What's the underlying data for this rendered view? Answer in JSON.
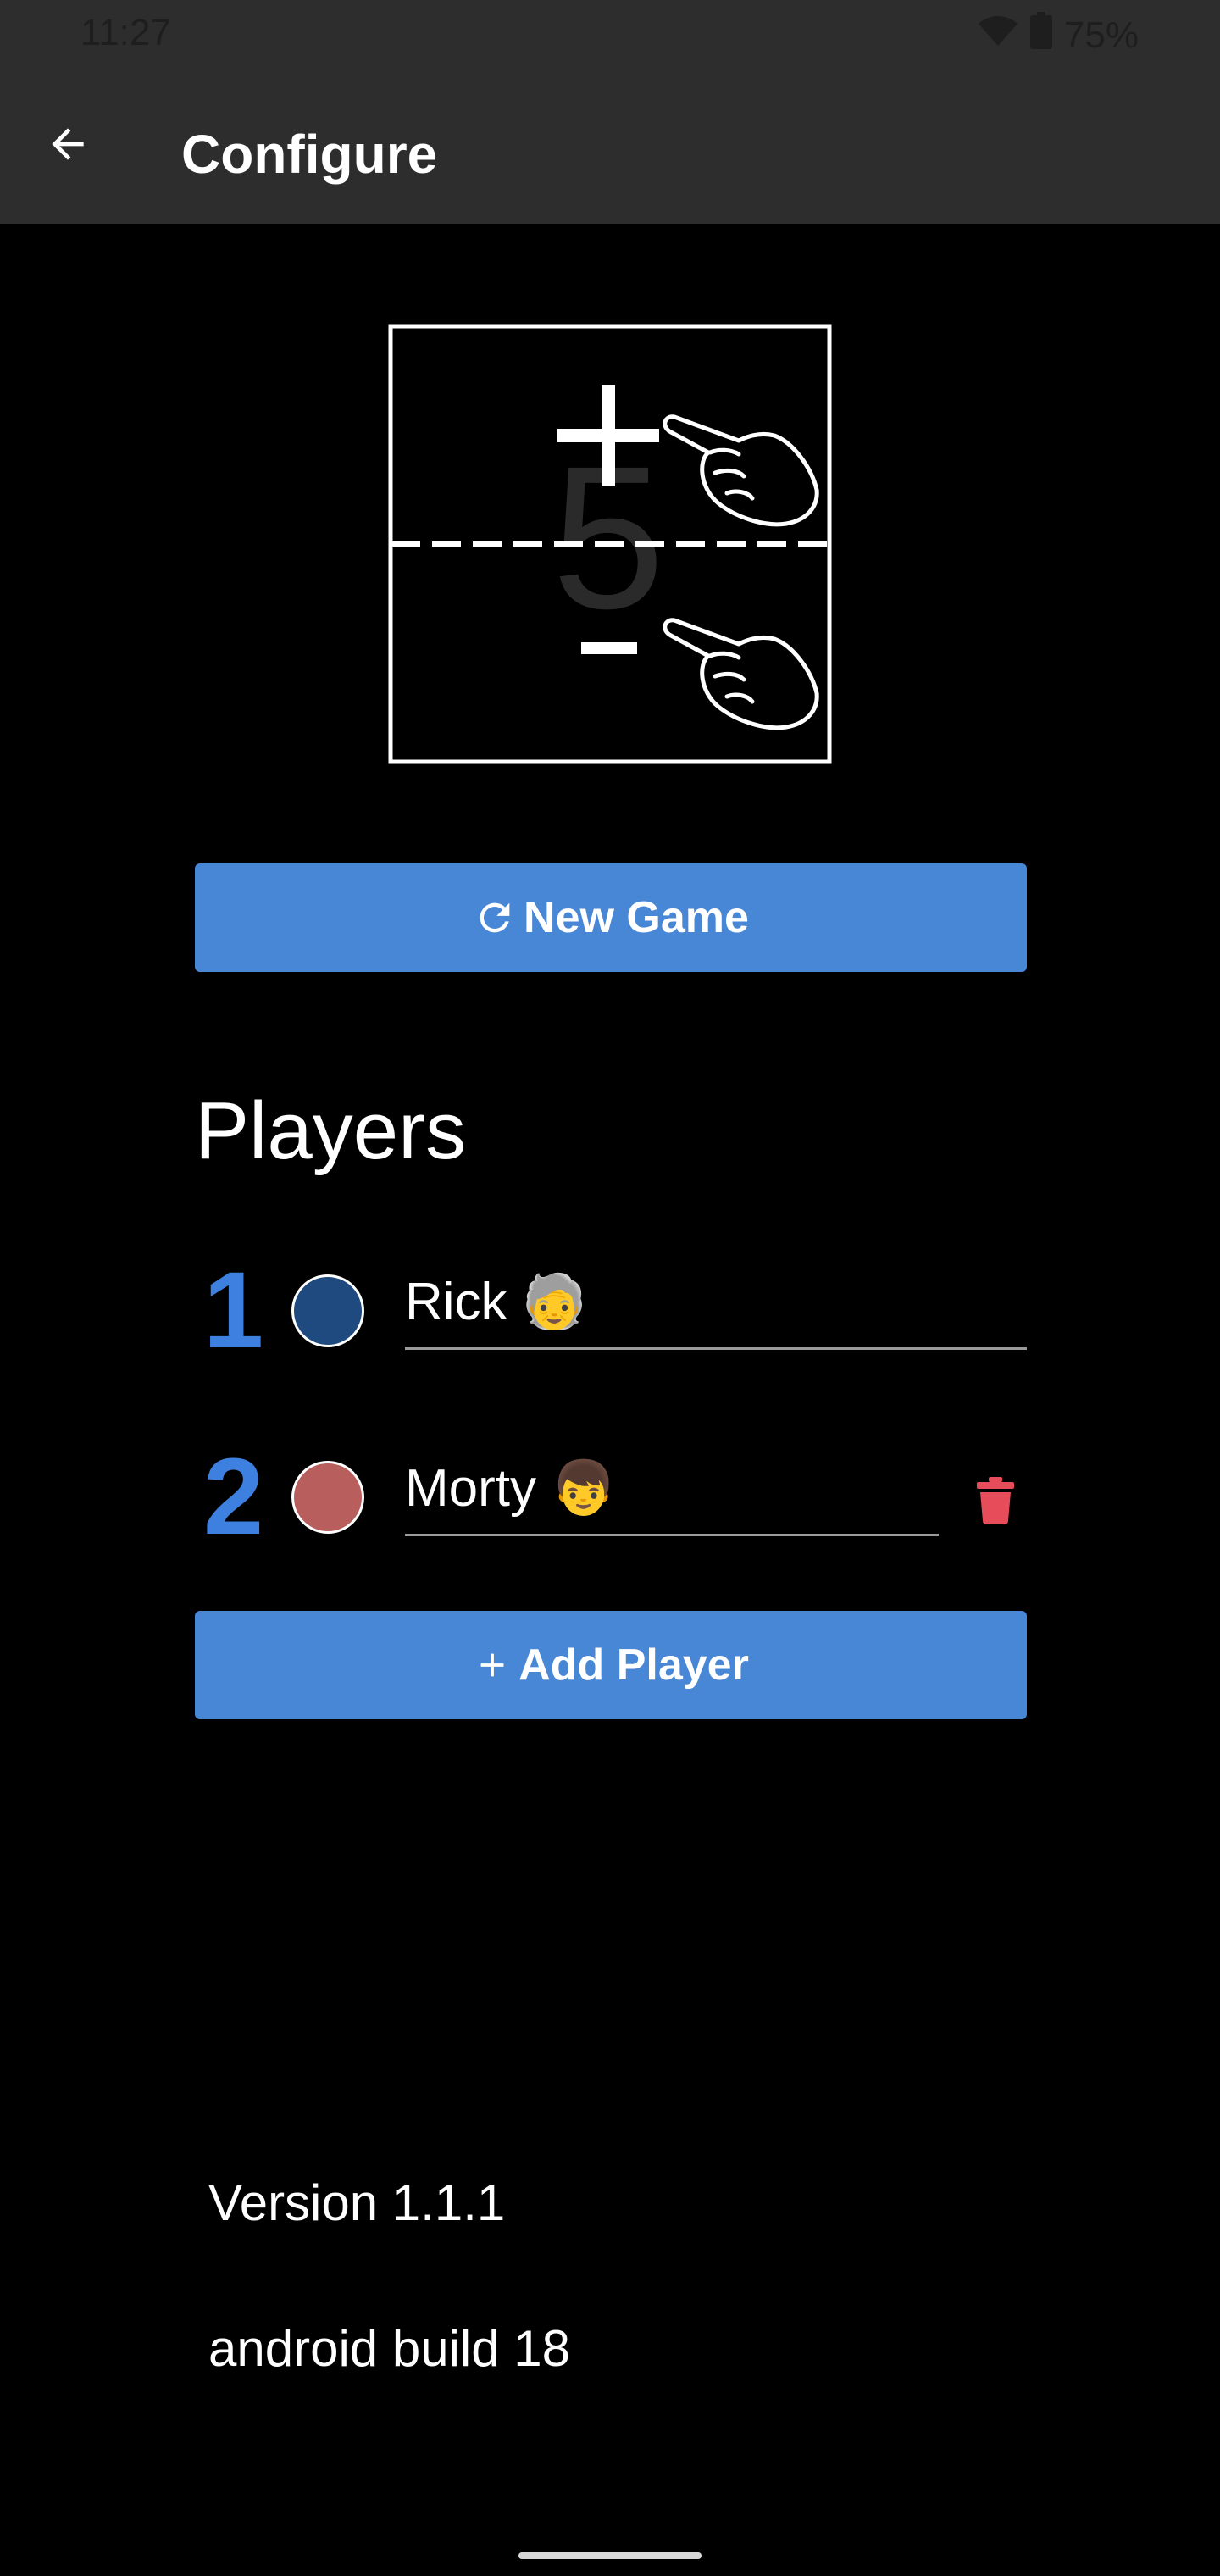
{
  "status_bar": {
    "time": "11:27",
    "battery": "75%",
    "icons": [
      "wifi-icon",
      "battery-icon"
    ]
  },
  "app_bar": {
    "title": "Configure",
    "back_icon": "arrow-left-icon"
  },
  "illustration": {
    "digit": "5",
    "plus": "+",
    "minus": "-",
    "icons": [
      "plus-icon",
      "minus-icon",
      "pointing-hand-icon"
    ]
  },
  "new_game_button": {
    "label": "New Game",
    "icon": "refresh-icon"
  },
  "players": {
    "heading": "Players",
    "items": [
      {
        "number": "1",
        "name": "Rick 🧓",
        "color": "#1f4a80"
      },
      {
        "number": "2",
        "name": "Morty 👦",
        "color": "#b85f5d"
      }
    ]
  },
  "add_player_button": {
    "label": "Add Player",
    "icon": "plus-icon"
  },
  "footer": {
    "version": "Version 1.1.1",
    "build": "android build 18"
  },
  "colors": {
    "accent": "#4787d6",
    "number": "#3d80e0",
    "delete": "#e74c5a",
    "bar": "#2d2d2d"
  }
}
